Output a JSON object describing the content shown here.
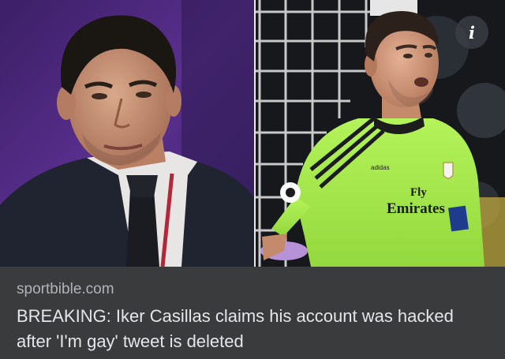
{
  "link_preview": {
    "source_domain": "sportbible.com",
    "headline": "BREAKING: Iker Casillas claims his account was hacked after 'I'm gay' tweet is deleted",
    "info_icon": "info-icon",
    "jersey": {
      "brand": "adidas",
      "sponsor_line1": "Fly",
      "sponsor_line2": "Emirates"
    }
  },
  "colors": {
    "card_background": "#3a3b3c",
    "headline_text": "#e4e6eb",
    "source_text": "#b0b3b8",
    "jersey_green": "#a6ea4e",
    "left_backdrop_purple": "#4d2a7e"
  }
}
